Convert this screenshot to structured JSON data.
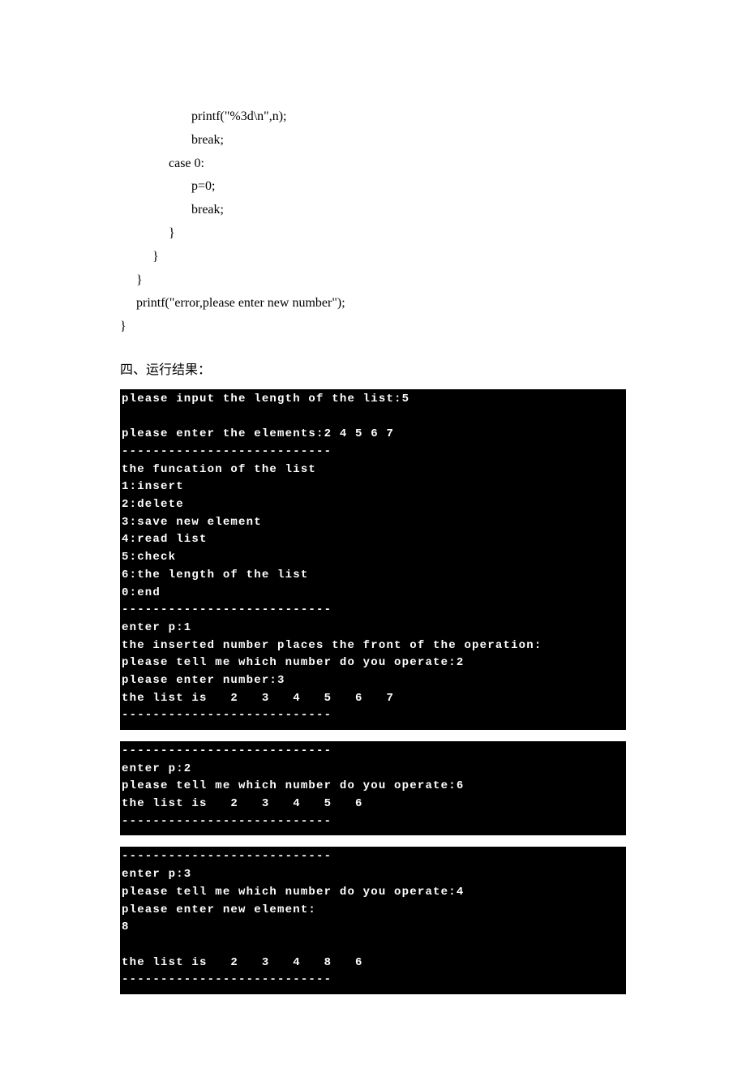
{
  "code_snippet": "                      printf(\"%3d\\n\",n);\n                      break;\n               case 0:\n                      p=0;\n                      break;\n               }\n          }\n     }\n     printf(\"error,please enter new number\");\n}",
  "section_title": "四、运行结果：",
  "terminal1": "please input the length of the list:5\n\nplease enter the elements:2 4 5 6 7\n---------------------------\nthe funcation of the list\n1:insert\n2:delete\n3:save new element\n4:read list\n5:check\n6:the length of the list\n0:end\n---------------------------\nenter p:1\nthe inserted number places the front of the operation:\nplease tell me which number do you operate:2\nplease enter number:3\nthe list is   2   3   4   5   6   7\n---------------------------",
  "terminal2": "---------------------------\nenter p:2\nplease tell me which number do you operate:6\nthe list is   2   3   4   5   6\n---------------------------",
  "terminal3": "---------------------------\nenter p:3\nplease tell me which number do you operate:4\nplease enter new element:\n8\n\nthe list is   2   3   4   8   6\n---------------------------"
}
